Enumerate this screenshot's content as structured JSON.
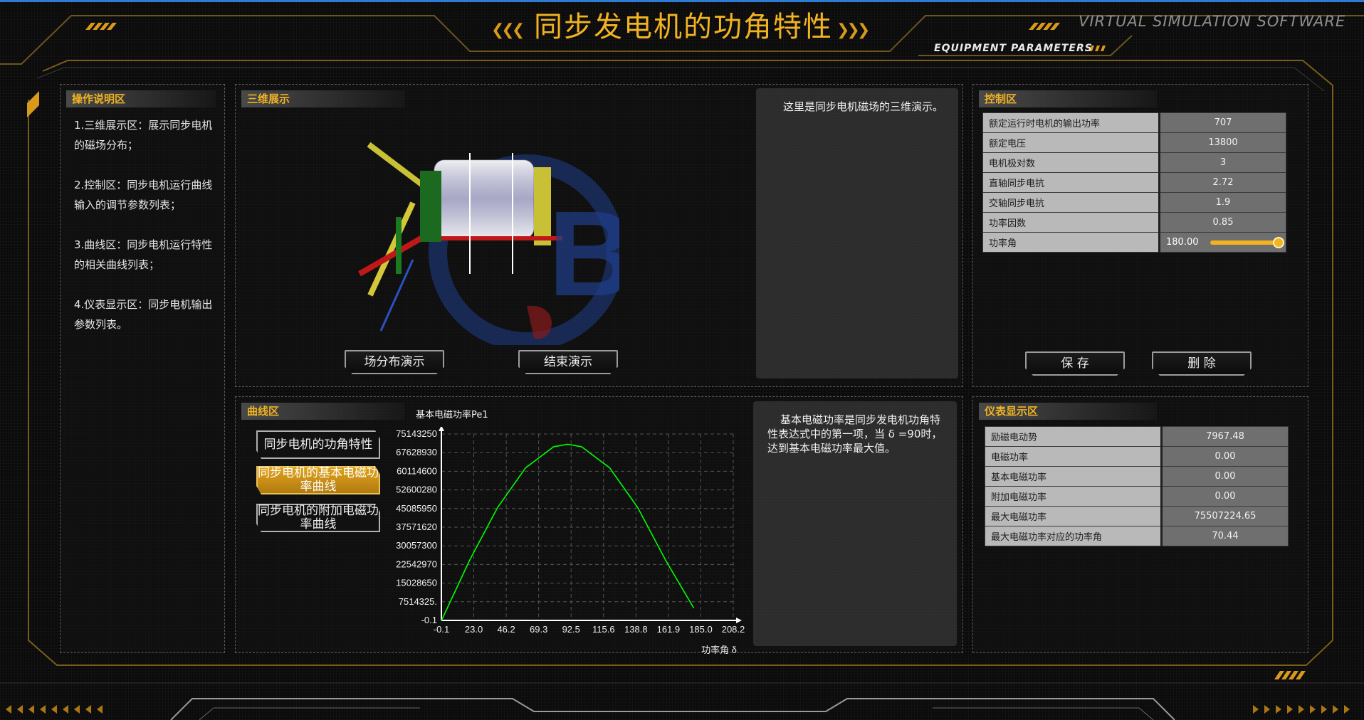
{
  "header": {
    "title": "同步发电机的功角特性",
    "brand": "VIRTUAL SIMULATION SOFTWARE",
    "equipment_label": "EQUIPMENT PARAMETERS"
  },
  "colors": {
    "accent": "#f2b321",
    "curve": "#00ff00",
    "top_line": "#2e7bd6"
  },
  "instructions": {
    "heading": "操作说明区",
    "items": [
      "1.三维展示区：展示同步电机的磁场分布；",
      "2.控制区：同步电机运行曲线输入的调节参数列表；",
      "3.曲线区：同步电机运行特性的相关曲线列表；",
      "4.仪表显示区：同步电机输出参数列表。"
    ]
  },
  "view3d": {
    "heading": "三维展示",
    "description": "这里是同步电机磁场的三维演示。",
    "buttons": {
      "start": "场分布演示",
      "stop": "结束演示"
    },
    "watermark": "BR"
  },
  "control": {
    "heading": "控制区",
    "rows": [
      {
        "label": "额定运行时电机的输出功率",
        "value": "707"
      },
      {
        "label": "额定电压",
        "value": "13800"
      },
      {
        "label": "电机极对数",
        "value": "3"
      },
      {
        "label": "直轴同步电抗",
        "value": "2.72"
      },
      {
        "label": "交轴同步电抗",
        "value": "1.9"
      },
      {
        "label": "功率因数",
        "value": "0.85"
      }
    ],
    "angle": {
      "label": "功率角",
      "value": "180.00",
      "fraction": 1.0
    },
    "buttons": {
      "save": "保 存",
      "delete": "删 除"
    }
  },
  "curves": {
    "heading": "曲线区",
    "buttons": [
      {
        "label": "同步电机的功角特性",
        "active": false
      },
      {
        "label": "同步电机的基本电磁功率曲线",
        "active": true
      },
      {
        "label": "同步电机的附加电磁功率曲线",
        "active": false
      }
    ],
    "description": "基本电磁功率是同步发电机功角特性表达式中的第一项，当 δ =90时，达到基本电磁功率最大值。"
  },
  "chart_data": {
    "type": "line",
    "title": "基本电磁功率Pe1",
    "xlabel": "功率角 δ",
    "ylabel": "",
    "xlim": [
      -0.1,
      208.2
    ],
    "ylim": [
      -0.1,
      75143250
    ],
    "x_ticks": [
      "-0.1",
      "23.0",
      "46.2",
      "69.3",
      "92.5",
      "115.6",
      "138.8",
      "161.9",
      "185.0",
      "208.2"
    ],
    "y_ticks": [
      "-0.1",
      "7514325.",
      "15028650",
      "22542970",
      "30057300",
      "37571620",
      "45085950",
      "52600280",
      "60114600",
      "67628930",
      "75143250"
    ],
    "grid": true,
    "series": [
      {
        "x": [
          0,
          20,
          40,
          60,
          80,
          90,
          100,
          120,
          140,
          160,
          180
        ],
        "values": [
          0,
          24200000,
          45500000,
          61500000,
          70000000,
          71000000,
          70000000,
          61500000,
          45500000,
          24200000,
          5000000
        ]
      }
    ]
  },
  "meter": {
    "heading": "仪表显示区",
    "rows": [
      {
        "label": "励磁电动势",
        "value": "7967.48"
      },
      {
        "label": "电磁功率",
        "value": "0.00"
      },
      {
        "label": "基本电磁功率",
        "value": "0.00"
      },
      {
        "label": "附加电磁功率",
        "value": "0.00"
      },
      {
        "label": "最大电磁功率",
        "value": "75507224.65"
      },
      {
        "label": "最大电磁功率对应的功率角",
        "value": "70.44"
      }
    ]
  }
}
